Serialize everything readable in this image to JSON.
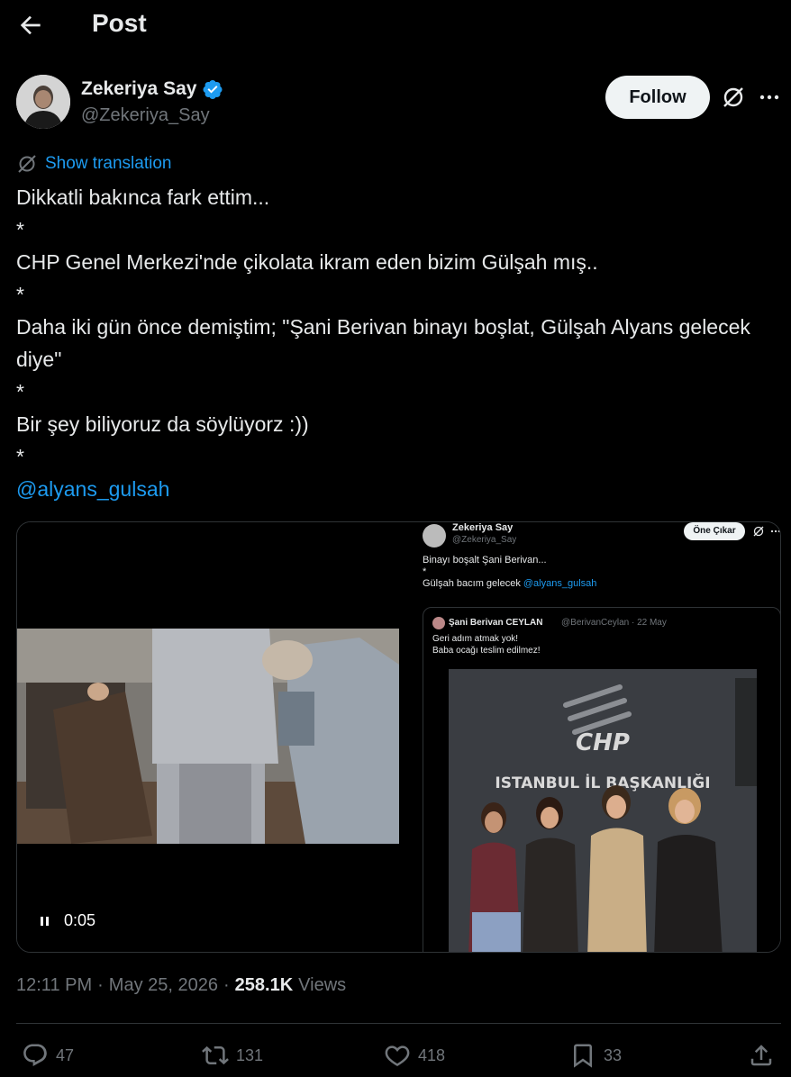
{
  "header": {
    "title": "Post",
    "back_icon": "arrow-left-icon"
  },
  "author": {
    "name": "Zekeriya Say",
    "handle": "@Zekeriya_Say",
    "verified": true,
    "follow_label": "Follow"
  },
  "translation": {
    "label": "Show translation"
  },
  "tweet": {
    "lines": [
      "Dikkatli bakınca fark ettim...",
      "*",
      "CHP Genel Merkezi'nde çikolata ikram eden bizim Gülşah mış..",
      "*",
      "Daha iki gün önce demiştim; \"Şani Berivan binayı boşlat, Gülşah Alyans gelecek diye\"",
      "*",
      "Bir şey biliyoruz da söylüyorz :))",
      "*"
    ],
    "mention": "@alyans_gulsah"
  },
  "video": {
    "time": "0:05",
    "state": "playing"
  },
  "screenshot": {
    "name": "Zekeriya Say",
    "handle": "@Zekeriya_Say",
    "follow_label": "Öne Çıkar",
    "line1": "Binayı boşalt Şani Berivan...",
    "line2": "*",
    "line3": "Gülşah bacım gelecek ",
    "mention": "@alyans_gulsah",
    "quote": {
      "name": "Şani Berivan CEYLAN",
      "meta": "@BerivanCeylan · 22 May",
      "line1": "Geri adım atmak yok!",
      "line2": "Baba ocağı teslim edilmez!",
      "sign_line1": "CHP",
      "sign_line2": "ISTANBUL İL BAŞKANLIĞI"
    }
  },
  "meta": {
    "time": "12:11 PM",
    "date": "May 25, 2026",
    "sep": "·",
    "views_count": "258.1K",
    "views_label": "Views"
  },
  "actions": {
    "replies": "47",
    "reposts": "131",
    "likes": "418",
    "bookmarks": "33"
  },
  "colors": {
    "accent": "#1d9bf0",
    "background": "#000000",
    "text": "#e7e9ea",
    "muted": "#71767b"
  }
}
